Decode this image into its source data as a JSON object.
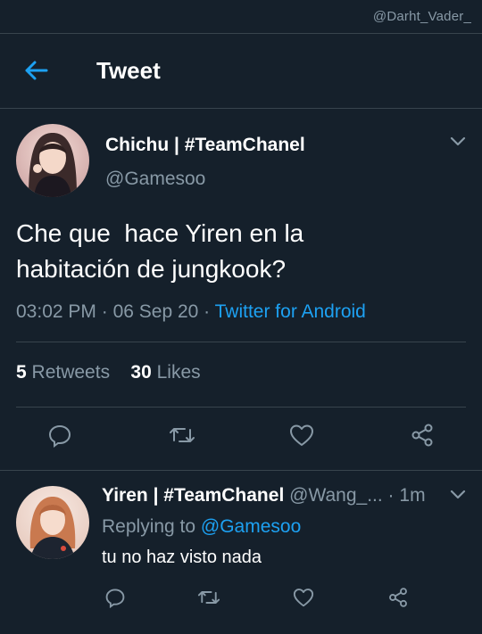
{
  "watermark": "@Darht_Vader_",
  "header": {
    "title": "Tweet",
    "back_icon": "arrow-left-icon"
  },
  "colors": {
    "background": "#15202b",
    "accent": "#1da1f2",
    "muted": "#8899a6",
    "divider": "#38444d"
  },
  "tweet": {
    "name": "Chichu | #TeamChanel",
    "handle": "@Gamesoo",
    "text": "Che que  hace Yiren en la\nhabitación de jungkook?",
    "time": "03:02 PM",
    "date": "06 Sep 20",
    "source": "Twitter for Android",
    "retweet_count": "5",
    "retweet_label": "Retweets",
    "like_count": "30",
    "like_label": "Likes",
    "actions": [
      "reply-icon",
      "retweet-icon",
      "like-icon",
      "share-icon"
    ]
  },
  "reply": {
    "name": "Yiren | #TeamChanel",
    "handle": "@Wang_...",
    "age": "1m",
    "replying_prefix": "Replying to",
    "replying_to": "@Gamesoo",
    "text": "tu no haz visto nada",
    "actions": [
      "reply-icon",
      "retweet-icon",
      "like-icon",
      "share-icon"
    ]
  }
}
